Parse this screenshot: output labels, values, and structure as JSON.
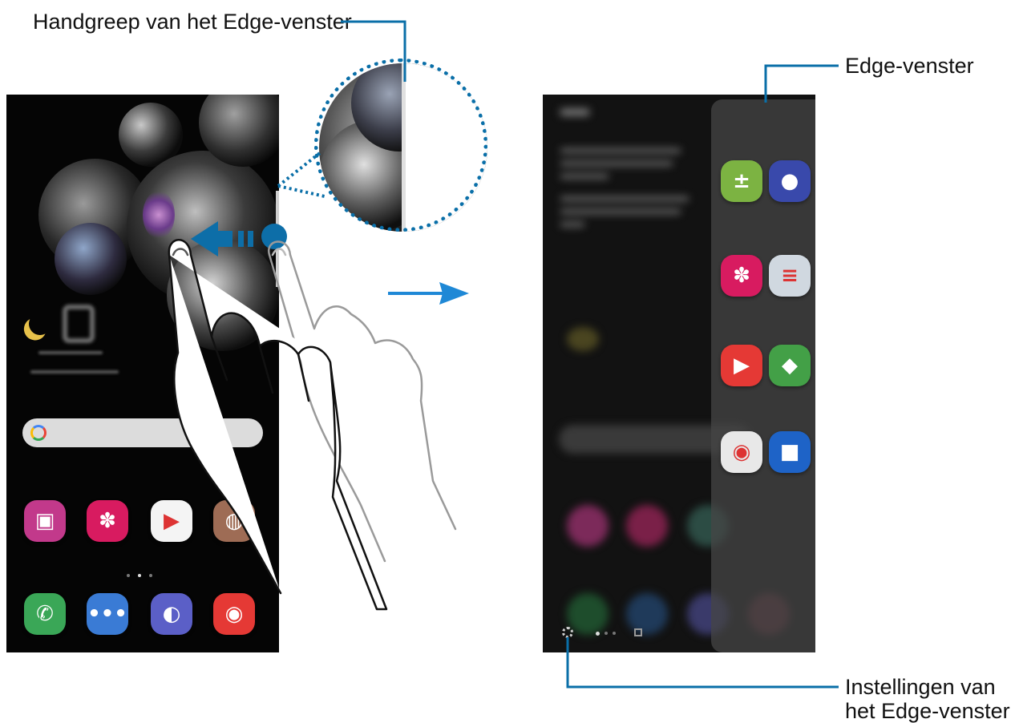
{
  "callouts": {
    "handle": "Handgreep van het Edge-venster",
    "panel": "Edge-venster",
    "settings_line1": "Instellingen van",
    "settings_line2": "het Edge-venster"
  },
  "left_phone": {
    "home_apps": [
      {
        "name": "galaxy-store",
        "color": "#c2398b",
        "glyph": "▣"
      },
      {
        "name": "gallery",
        "color": "#d81b60",
        "glyph": "✽"
      },
      {
        "name": "play-store",
        "color": "#f4f4f4",
        "glyph": "▶"
      },
      {
        "name": "google-folder",
        "color": "#9e6c55",
        "glyph": "◍"
      }
    ],
    "dock_apps": [
      {
        "name": "phone",
        "color": "#3aa757",
        "glyph": "✆"
      },
      {
        "name": "messages",
        "color": "#3a7bd5",
        "glyph": "•••"
      },
      {
        "name": "internet",
        "color": "#5b5fc7",
        "glyph": "◐"
      },
      {
        "name": "camera",
        "color": "#e53935",
        "glyph": "◉"
      }
    ]
  },
  "right_phone": {
    "edge_apps": [
      {
        "name": "calculator",
        "color": "#7cb342",
        "glyph": "±"
      },
      {
        "name": "pair",
        "color": "#3949ab",
        "glyph": "●"
      },
      {
        "name": "gallery",
        "color": "#d81b60",
        "glyph": "✽"
      },
      {
        "name": "notes",
        "color": "#d0d8e0",
        "glyph": "≡"
      },
      {
        "name": "youtube",
        "color": "#e53935",
        "glyph": "▶"
      },
      {
        "name": "maps",
        "color": "#43a047",
        "glyph": "◆"
      },
      {
        "name": "chrome",
        "color": "#e8e8e8",
        "glyph": "◉"
      },
      {
        "name": "meet",
        "color": "#1e63c7",
        "glyph": "■"
      }
    ]
  },
  "colors": {
    "accent": "#0a6fa8",
    "arrow": "#1e88d6",
    "dot": "#0d6ea8"
  }
}
